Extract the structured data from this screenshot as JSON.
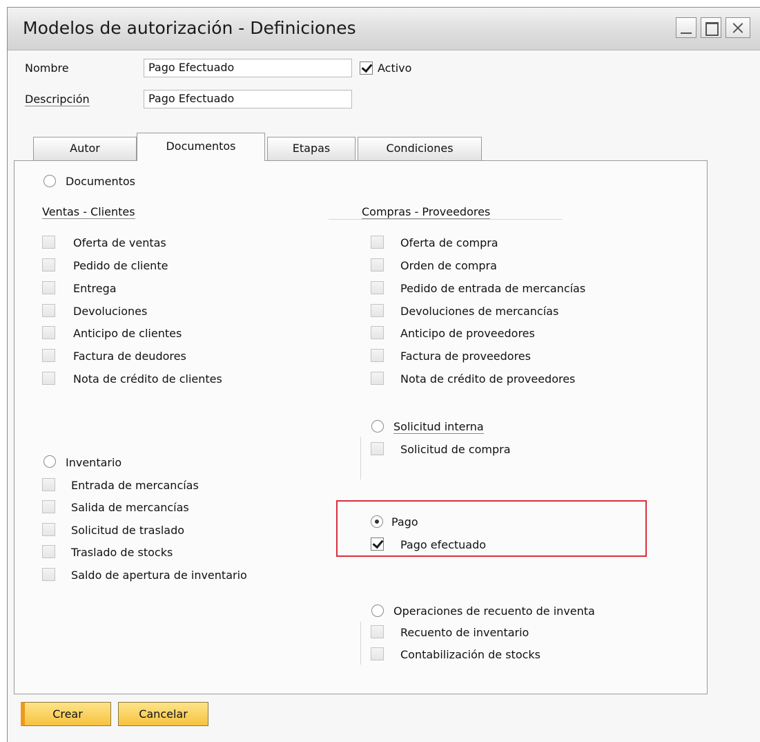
{
  "window": {
    "title": "Modelos de autorización - Definiciones"
  },
  "header": {
    "name_label": "Nombre",
    "name_value": "Pago Efectuado",
    "active_label": "Activo",
    "active_checked": true,
    "description_label": "Descripción",
    "description_value": "Pago Efectuado"
  },
  "tabs": [
    {
      "label": "Autor",
      "active": false
    },
    {
      "label": "Documentos",
      "active": true
    },
    {
      "label": "Etapas",
      "active": false
    },
    {
      "label": "Condiciones",
      "active": false
    }
  ],
  "documents": {
    "radio_label": "Documentos",
    "sales": {
      "heading": "Ventas - Clientes",
      "items": [
        "Oferta de ventas",
        "Pedido de cliente",
        "Entrega",
        "Devoluciones",
        "Anticipo de clientes",
        "Factura de deudores",
        "Nota de crédito de clientes"
      ]
    },
    "purchases": {
      "heading": "Compras - Proveedores",
      "items": [
        "Oferta de compra",
        "Orden de compra",
        "Pedido de entrada de mercancías",
        "Devoluciones de mercancías",
        "Anticipo de proveedores",
        "Factura de proveedores",
        "Nota de crédito de proveedores"
      ]
    }
  },
  "inventory": {
    "radio_label": "Inventario",
    "items": [
      "Entrada de mercancías",
      "Salida de mercancías",
      "Solicitud de traslado",
      "Traslado de stocks",
      "Saldo de apertura de inventario"
    ]
  },
  "internal_request": {
    "radio_label": "Solicitud interna",
    "items": [
      "Solicitud de compra"
    ]
  },
  "payment": {
    "radio_label": "Pago",
    "selected": true,
    "items": [
      {
        "label": "Pago efectuado",
        "checked": true
      }
    ]
  },
  "inventory_counting": {
    "radio_label": "Operaciones de recuento de inventa",
    "items": [
      "Recuento de inventario",
      "Contabilización de stocks"
    ]
  },
  "buttons": {
    "create": "Crear",
    "cancel": "Cancelar"
  },
  "colors": {
    "highlight": "#d7303c",
    "button": "#f7c23e",
    "button_accent": "#ec9a1c"
  }
}
